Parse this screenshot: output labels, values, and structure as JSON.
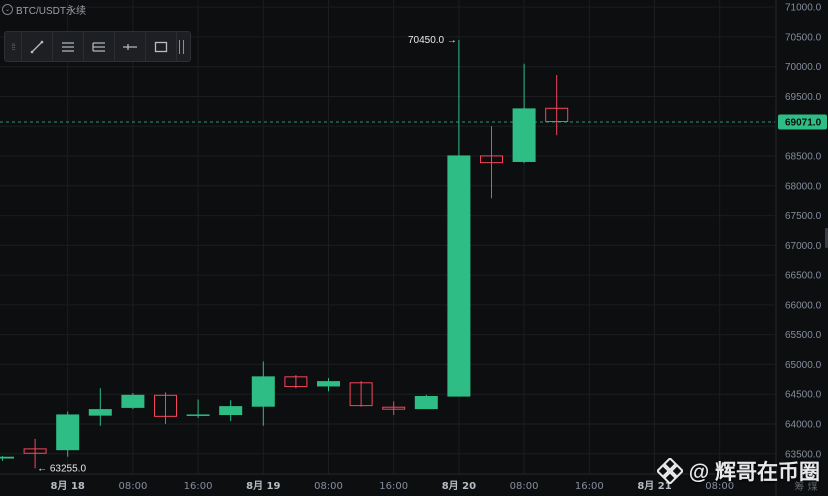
{
  "symbol": {
    "label": "BTC/USDT永续"
  },
  "toolbar": {
    "tools": [
      {
        "name": "trend-line-icon"
      },
      {
        "name": "parallel-channel-icon"
      },
      {
        "name": "fib-levels-icon"
      },
      {
        "name": "horizontal-line-icon"
      },
      {
        "name": "rectangle-icon"
      }
    ]
  },
  "colors": {
    "background": "#0d0e10",
    "up": "#2ebd85",
    "down": "#f6465d",
    "grid": "#1b1d21",
    "price_line": "#2ebd85",
    "price_tag": "#2ebd85",
    "axis_text": "#848e9c"
  },
  "watermark": {
    "text": "@ 辉哥在币圈"
  },
  "axis_footer": {
    "text": "筹 煤"
  },
  "chart_data": {
    "type": "candlestick",
    "timeframe_hours": 4,
    "x_tick_labels": [
      {
        "label": "8月 18",
        "index": 2
      },
      {
        "label": "08:00",
        "index": 4
      },
      {
        "label": "16:00",
        "index": 6
      },
      {
        "label": "8月 19",
        "index": 8
      },
      {
        "label": "08:00",
        "index": 10
      },
      {
        "label": "16:00",
        "index": 12
      },
      {
        "label": "8月 20",
        "index": 14
      },
      {
        "label": "08:00",
        "index": 16
      },
      {
        "label": "16:00",
        "index": 18
      },
      {
        "label": "8月 21",
        "index": 20
      },
      {
        "label": "08:00",
        "index": 22
      }
    ],
    "y_ticks": [
      63500,
      64000,
      64500,
      65000,
      65500,
      66000,
      66500,
      67000,
      67500,
      68000,
      68500,
      69000,
      69500,
      70000,
      70500,
      71000
    ],
    "y_tick_format": "one_decimal",
    "ylim": [
      63160,
      71120
    ],
    "candles": [
      {
        "index": 0,
        "open": 63420,
        "high": 63460,
        "low": 63380,
        "close": 63450
      },
      {
        "index": 1,
        "open": 63590,
        "high": 63750,
        "low": 63255,
        "close": 63500
      },
      {
        "index": 2,
        "open": 63560,
        "high": 64210,
        "low": 63450,
        "close": 64160
      },
      {
        "index": 3,
        "open": 64140,
        "high": 64600,
        "low": 63970,
        "close": 64250
      },
      {
        "index": 4,
        "open": 64270,
        "high": 64520,
        "low": 64250,
        "close": 64490
      },
      {
        "index": 5,
        "open": 64490,
        "high": 64530,
        "low": 64000,
        "close": 64120
      },
      {
        "index": 6,
        "open": 64140,
        "high": 64410,
        "low": 64100,
        "close": 64160
      },
      {
        "index": 7,
        "open": 64150,
        "high": 64400,
        "low": 64050,
        "close": 64300
      },
      {
        "index": 8,
        "open": 64290,
        "high": 65050,
        "low": 63970,
        "close": 64800
      },
      {
        "index": 9,
        "open": 64800,
        "high": 64820,
        "low": 64600,
        "close": 64620
      },
      {
        "index": 10,
        "open": 64630,
        "high": 64770,
        "low": 64550,
        "close": 64720
      },
      {
        "index": 11,
        "open": 64700,
        "high": 64720,
        "low": 64290,
        "close": 64300
      },
      {
        "index": 12,
        "open": 64290,
        "high": 64380,
        "low": 64150,
        "close": 64240
      },
      {
        "index": 13,
        "open": 64250,
        "high": 64490,
        "low": 64250,
        "close": 64470
      },
      {
        "index": 14,
        "open": 64460,
        "high": 70450,
        "low": 64460,
        "close": 68510
      },
      {
        "index": 15,
        "open": 68510,
        "high": 69000,
        "low": 67790,
        "close": 68380
      },
      {
        "index": 16,
        "open": 68400,
        "high": 70050,
        "low": 68380,
        "close": 69300
      },
      {
        "index": 17,
        "open": 69310,
        "high": 69860,
        "low": 68850,
        "close": 69071
      }
    ],
    "current_price": 69071.0,
    "current_price_label": "69071.0",
    "annotations": [
      {
        "label": "70450.0",
        "value": 70450,
        "index": 14,
        "kind": "high"
      },
      {
        "label": "63255.0",
        "value": 63255,
        "index": 1,
        "kind": "low"
      }
    ]
  }
}
